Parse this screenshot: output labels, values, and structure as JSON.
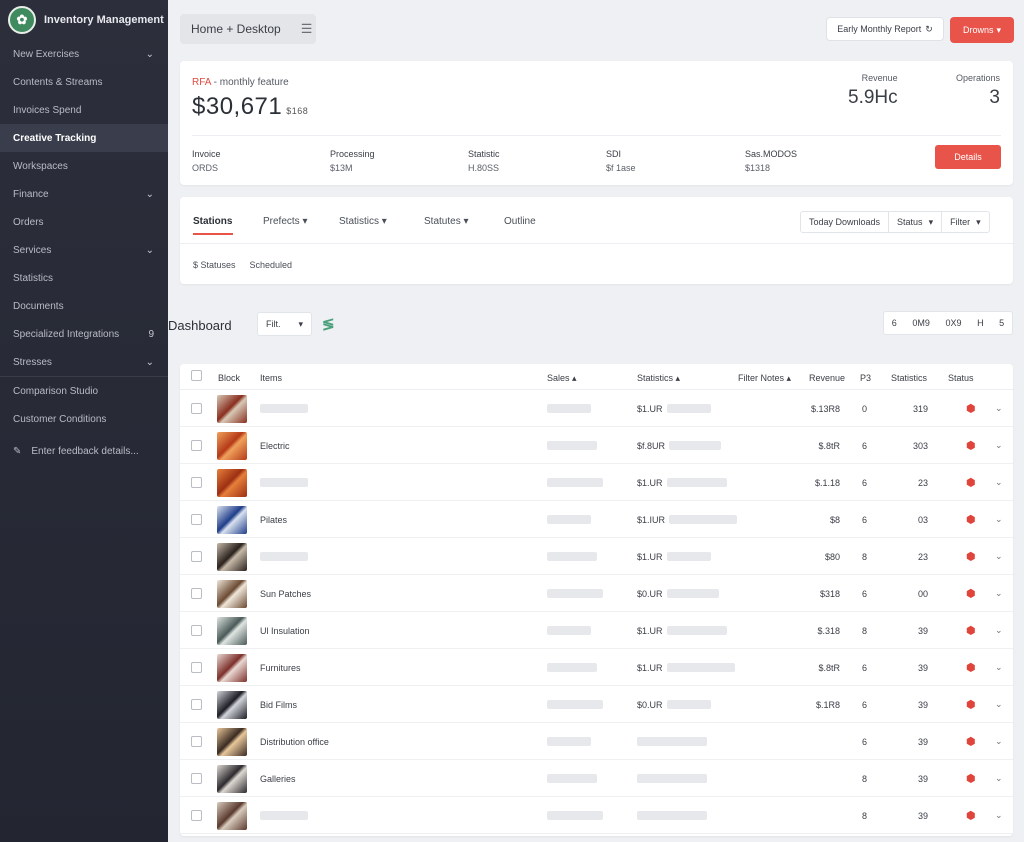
{
  "sidebar": {
    "brand": "Inventory Management",
    "items": [
      {
        "label": "New Exercises",
        "chevron": true,
        "active": false
      },
      {
        "label": "Contents & Streams",
        "chevron": false,
        "active": false
      },
      {
        "label": "Invoices Spend",
        "chevron": false,
        "active": false
      },
      {
        "label": "Creative Tracking",
        "chevron": false,
        "active": true
      },
      {
        "label": "Workspaces",
        "chevron": false,
        "active": false
      },
      {
        "label": "Finance",
        "chevron": true,
        "active": false
      },
      {
        "label": "Orders",
        "chevron": false,
        "active": false
      },
      {
        "label": "Services",
        "chevron": true,
        "active": false
      },
      {
        "label": "Statistics",
        "chevron": false,
        "active": false
      },
      {
        "label": "Documents",
        "chevron": false,
        "active": false
      },
      {
        "label": "Specialized Integrations",
        "chevron": false,
        "active": false,
        "badge": "9"
      },
      {
        "label": "Stresses",
        "chevron": true,
        "active": false
      }
    ],
    "footer_items": [
      "Comparison Studio",
      "Customer Conditions"
    ],
    "bottom_link": "Enter feedback details..."
  },
  "topbar": {
    "crumb": "Home + Desktop",
    "link": "Early Monthly Report",
    "button": "Drowns"
  },
  "summary": {
    "label_prefix": "RFA",
    "label_rest": " - monthly feature",
    "amount": "$30,671",
    "amount_suffix": "$168",
    "kpi1_label": "Revenue",
    "kpi1_value": "5.9Hc",
    "kpi2_label": "Operations",
    "kpi2_value": "3",
    "stats": [
      {
        "label": "Invoice",
        "value": "ORDS"
      },
      {
        "label": "Processing",
        "value": "$13M"
      },
      {
        "label": "Statistic",
        "value": "H.80SS"
      },
      {
        "label": "SDI",
        "value": "$f 1ase"
      },
      {
        "label": "Sas.MODOS",
        "value": "$1318"
      }
    ],
    "button": "Details"
  },
  "tabs": {
    "items": [
      "Stations",
      "Prefects",
      "Statistics",
      "Statutes",
      "Outline"
    ],
    "filters": [
      "Today Downloads",
      "Status",
      "Filter"
    ],
    "sub_filters": [
      "$ Statuses",
      "Scheduled"
    ]
  },
  "section": {
    "title": "Dashboard",
    "select": "Filt.",
    "pager": [
      "6",
      "0M9",
      "0X9",
      "H",
      "5"
    ]
  },
  "table": {
    "headers": [
      "Block",
      "Items",
      "Sales",
      "Statistics",
      "Filter Notes",
      "Revenue",
      "P3",
      "Statistics",
      "Status"
    ],
    "rows": [
      {
        "name": "",
        "code": "$1.UR",
        "rev": "$.13R8",
        "a": "0",
        "b": "319",
        "colors": [
          "#8a2e1f",
          "#d7c9b5"
        ]
      },
      {
        "name": "Electric",
        "code": "$f.8UR",
        "rev": "$.8tR",
        "a": "6",
        "b": "303",
        "colors": [
          "#b53a18",
          "#f0a15c"
        ]
      },
      {
        "name": "",
        "code": "$1.UR",
        "rev": "$.1.18",
        "a": "6",
        "b": "23",
        "colors": [
          "#9c2f12",
          "#e77f3b"
        ]
      },
      {
        "name": "Pilates",
        "code": "$1.IUR",
        "rev": "$8",
        "a": "6",
        "b": "03",
        "colors": [
          "#1f3d8a",
          "#d9e2f0"
        ]
      },
      {
        "name": "",
        "code": "$1.UR",
        "rev": "$80",
        "a": "8",
        "b": "23",
        "colors": [
          "#2a211c",
          "#c6b9a8"
        ]
      },
      {
        "name": "Sun Patches",
        "code": "$0.UR",
        "rev": "$318",
        "a": "6",
        "b": "00",
        "colors": [
          "#6b4a32",
          "#efe6d9"
        ]
      },
      {
        "name": "Ul Insulation",
        "code": "$1.UR",
        "rev": "$.318",
        "a": "8",
        "b": "39",
        "colors": [
          "#4a5a58",
          "#dfe5e2"
        ]
      },
      {
        "name": "Furnitures",
        "code": "$1.UR",
        "rev": "$.8tR",
        "a": "6",
        "b": "39",
        "colors": [
          "#7d2f2b",
          "#ead9d3"
        ]
      },
      {
        "name": "Bid Films",
        "code": "$0.UR",
        "rev": "$.1R8",
        "a": "6",
        "b": "39",
        "colors": [
          "#1d1d24",
          "#d1d4da"
        ]
      },
      {
        "name": "Distribution office",
        "code": "",
        "rev": "",
        "a": "6",
        "b": "39",
        "colors": [
          "#3a2a22",
          "#e8c79a"
        ]
      },
      {
        "name": "Galleries",
        "code": "",
        "rev": "",
        "a": "8",
        "b": "39",
        "colors": [
          "#2d2a2f",
          "#ddd8d2"
        ]
      },
      {
        "name": "",
        "code": "",
        "rev": "",
        "a": "8",
        "b": "39",
        "colors": [
          "#5b3a2e",
          "#d8cbbd"
        ]
      }
    ]
  }
}
